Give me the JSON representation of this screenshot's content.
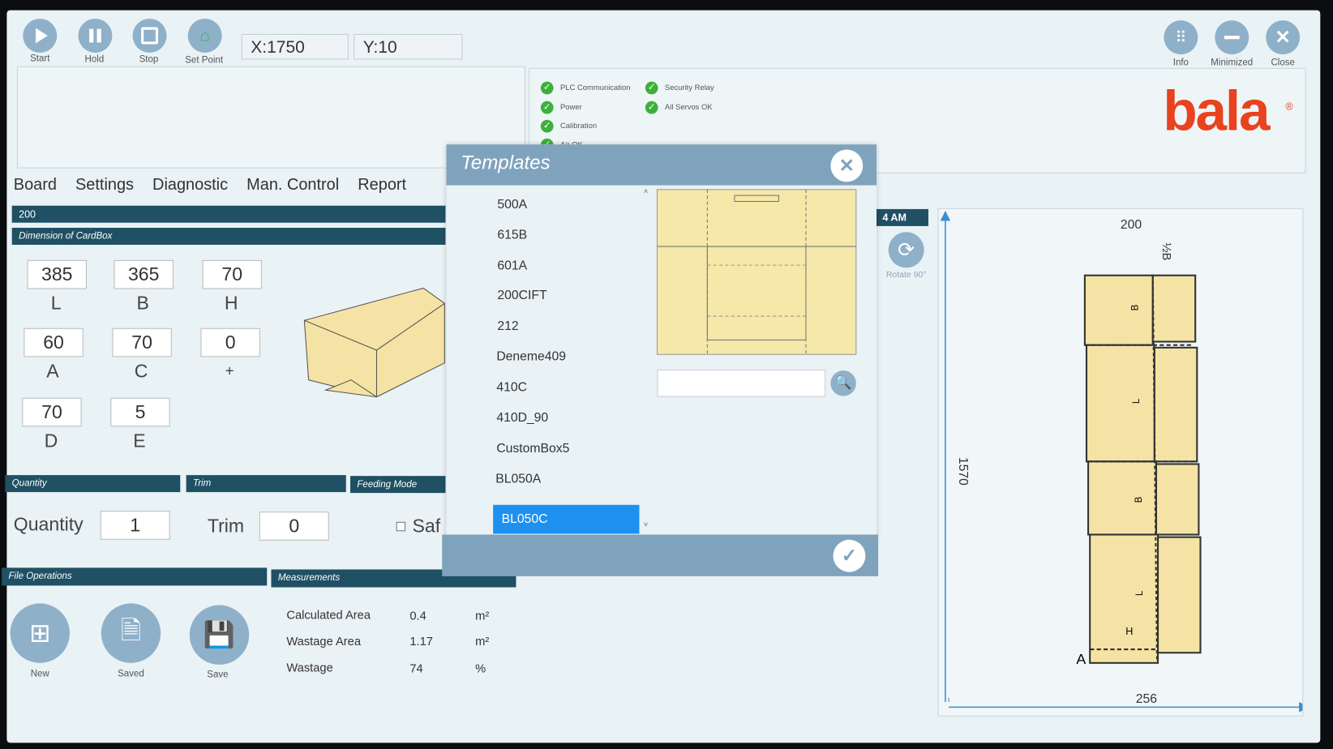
{
  "toolbar": {
    "start": "Start",
    "hold": "Hold",
    "stop": "Stop",
    "set_point": "Set Point",
    "x": "X:1750",
    "y": "Y:10",
    "info": "Info",
    "minimized": "Minimized",
    "close": "Close"
  },
  "status": [
    "PLC Communication",
    "Power",
    "Calibration",
    "Air OK",
    "Security Relay",
    "All Servos OK"
  ],
  "brand": {
    "logo": "bala",
    "reg": "®",
    "color": "#e8421e"
  },
  "menu": [
    "Board",
    "Settings",
    "Diagnostic",
    "Man. Control",
    "Report"
  ],
  "board_bar": "200",
  "dimension": {
    "title": "Dimension of CardBox",
    "fields": [
      {
        "v": "385",
        "l": "L"
      },
      {
        "v": "365",
        "l": "B"
      },
      {
        "v": "70",
        "l": "H"
      },
      {
        "v": "60",
        "l": "A"
      },
      {
        "v": "70",
        "l": "C"
      },
      {
        "v": "0",
        "l": "+"
      },
      {
        "v": "70",
        "l": "D"
      },
      {
        "v": "5",
        "l": "E"
      }
    ]
  },
  "sections": {
    "quantity": "Quantity",
    "trim": "Trim",
    "feeding": "Feeding Mode",
    "file_ops": "File Operations",
    "measurements": "Measurements"
  },
  "quantity": {
    "label": "Quantity",
    "value": "1"
  },
  "trim": {
    "label": "Trim",
    "value": "0"
  },
  "safe_label": "Saf",
  "file_ops": {
    "new": "New",
    "saved": "Saved",
    "save": "Save"
  },
  "measurements": [
    {
      "name": "Calculated Area",
      "value": "0.4",
      "unit": "m²"
    },
    {
      "name": "Wastage Area",
      "value": "1.17",
      "unit": "m²"
    },
    {
      "name": "Wastage",
      "value": "74",
      "unit": "%"
    }
  ],
  "time": "4 AM",
  "rotate": "Rotate 90°",
  "drawing": {
    "top": "200",
    "height": "1570",
    "bottom": "256",
    "half_b": "½B",
    "labels": [
      "B",
      "L",
      "B",
      "L",
      "H"
    ],
    "corner": "A"
  },
  "dialog": {
    "title": "Templates",
    "items": [
      "500A",
      "615B",
      "601A",
      "200CIFT",
      "212",
      "Deneme409",
      "410C",
      "410D_90",
      "CustomBox5",
      "BL050A",
      "BL050C"
    ],
    "selected": "BL050C",
    "search_value": ""
  }
}
